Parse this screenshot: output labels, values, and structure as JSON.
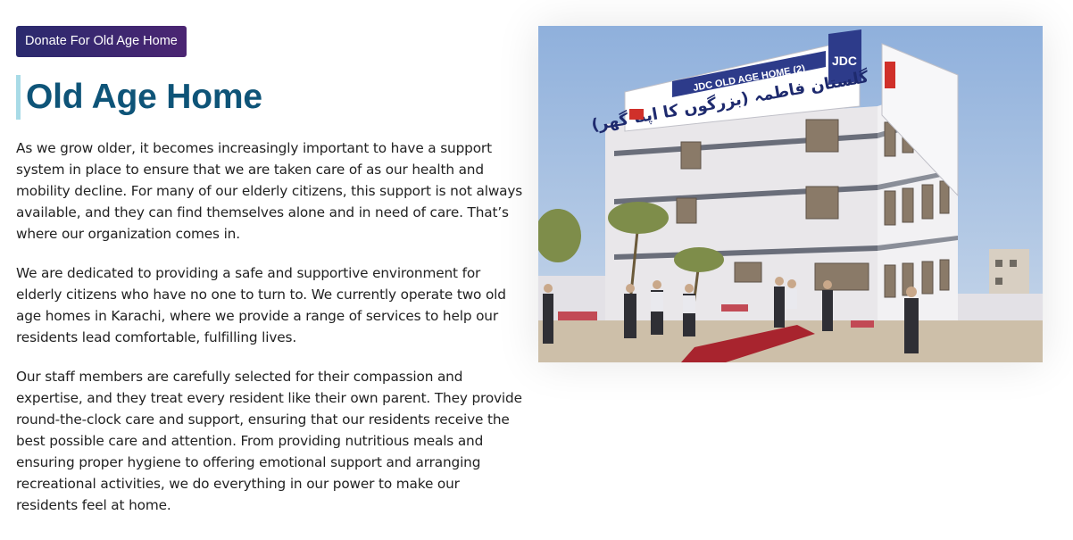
{
  "donate_button": {
    "label": "Donate For Old Age Home"
  },
  "heading": {
    "title": "Old Age Home"
  },
  "paragraphs": [
    "As we grow older, it becomes increasingly important to have a support system in place to ensure that we are taken care of as our health and mobility decline. For many of our elderly citizens, this support is not always available, and they can find themselves alone and in need of care. That’s where our organization comes in.",
    "We are dedicated to providing a safe and supportive environment for elderly citizens who have no one to turn to. We currently operate two old age homes in Karachi, where we provide a range of services to help our residents lead comfortable, fulfilling lives.",
    "Our staff members are carefully selected for their compassion and expertise, and they treat every resident like their own parent. They provide round-the-clock care and support, ensuring that our residents receive the best possible care and attention. From providing nutritious meals and ensuring proper hygiene to offering emotional support and arranging recreational activities, we do everything in our power to make our residents feel at home."
  ],
  "photo": {
    "sign_english": "JDC OLD AGE HOME (2)",
    "sign_urdu": "گلستان فاطمہ (بزرگوں کا اپنا گھر)",
    "logo_text": "JDC"
  },
  "colors": {
    "button_start": "#2a2a6e",
    "button_end": "#4b2572",
    "title": "#0e5478",
    "title_bar": "#a8dbe7",
    "body_text": "#222222"
  }
}
